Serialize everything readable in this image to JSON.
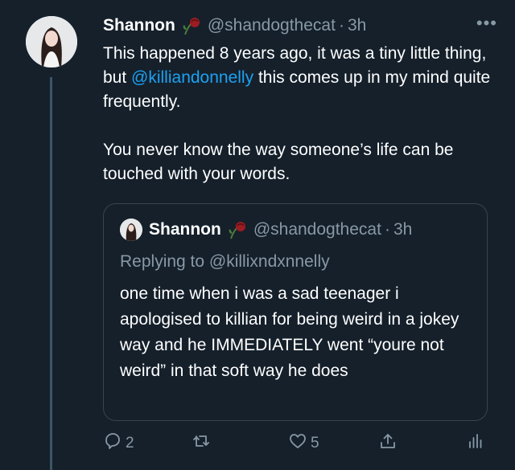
{
  "tweet": {
    "author_name": "Shannon",
    "handle": "@shandogthecat",
    "time": "3h",
    "more": "•••",
    "text_line1": "This happened 8 years ago, it was a tiny little thing, but ",
    "mention": "@killiandonnelly",
    "text_line1_end": " this comes up in my mind quite frequently.",
    "text_para2": "You never know the way someone’s life can be touched with your words."
  },
  "quote": {
    "author_name": "Shannon",
    "handle": "@shandogthecat",
    "time": "3h",
    "replying_label": "Replying to ",
    "replying_to": "@killixndxnnelly",
    "text": "one time when i was a sad teenager i apologised to killian for being weird in a jokey way and he IMMEDIATELY went “youre not weird” in that soft way he does"
  },
  "actions": {
    "reply_count": "2",
    "like_count": "5"
  },
  "colors": {
    "background": "#15202b",
    "link": "#1da1f2",
    "muted": "#8899a6",
    "border": "#38444d"
  },
  "icons": [
    "rose-emoji-icon",
    "reply-icon",
    "retweet-icon",
    "like-icon",
    "share-icon",
    "analytics-icon"
  ]
}
